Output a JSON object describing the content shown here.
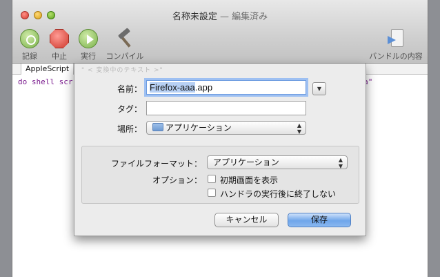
{
  "window": {
    "title": "名称未設定",
    "title_sep": " — ",
    "title_status": "編集済み"
  },
  "toolbar": {
    "record": "記録",
    "stop": "中止",
    "run": "実行",
    "compile": "コンパイル",
    "bundle": "バンドルの内容"
  },
  "editor": {
    "tab": "AppleScript",
    "code_left": "do shell scr",
    "code_right": "-P aaa\""
  },
  "sheet": {
    "ghost_text": "\" < 変換中のテキスト >\"",
    "name_label": "名前：",
    "name_value_selected": "Firefox-aaa",
    "name_value_ext": ".app",
    "disclose_icon": "▼",
    "tags_label": "タグ：",
    "tags_value": "",
    "where_label": "場所：",
    "where_value": "アプリケーション",
    "format_label": "ファイルフォーマット：",
    "format_value": "アプリケーション",
    "options_label": "オプション：",
    "opt_startup": "初期画面を表示",
    "opt_stay_open": "ハンドラの実行後に終了しない",
    "cancel": "キャンセル",
    "save": "保存"
  }
}
